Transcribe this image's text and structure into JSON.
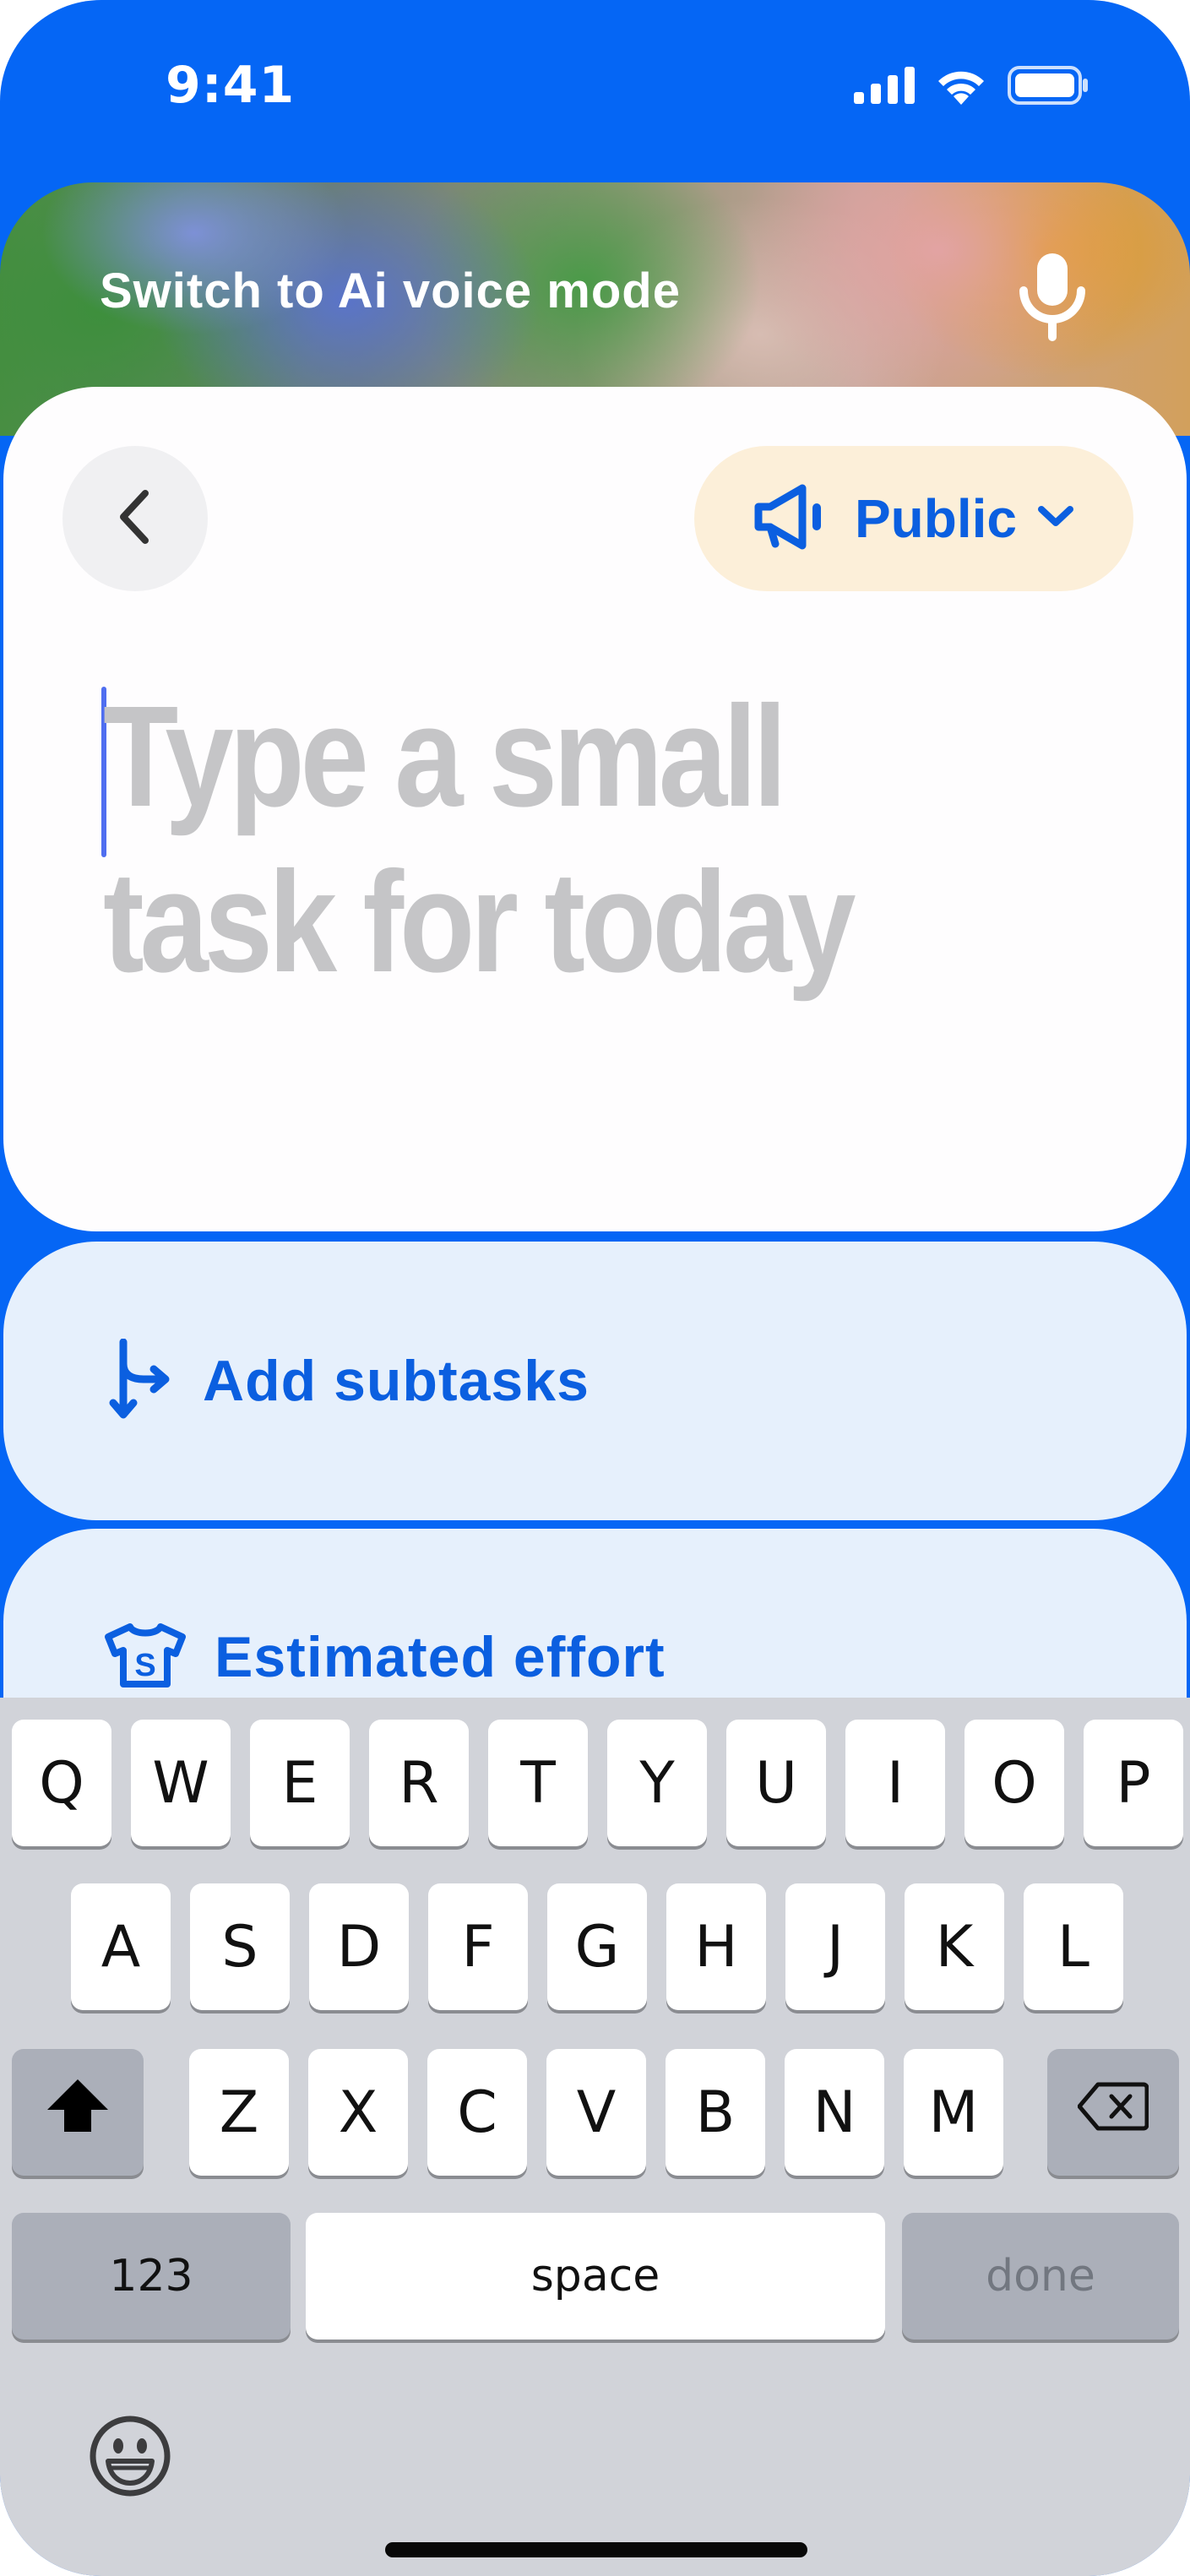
{
  "status_bar": {
    "time": "9:41",
    "signal_icon": "cellular-signal-icon",
    "wifi_icon": "wifi-icon",
    "battery_icon": "battery-icon"
  },
  "voice_banner": {
    "label": "Switch to Ai voice mode",
    "icon": "microphone-icon"
  },
  "task_card": {
    "back_icon": "chevron-left-icon",
    "visibility": {
      "label": "Public",
      "icon": "megaphone-icon",
      "dropdown_icon": "chevron-down-icon"
    },
    "input_placeholder_line1": "Type a small",
    "input_placeholder_line2": "task for today"
  },
  "subtasks": {
    "label": "Add subtasks",
    "icon": "split-arrows-icon"
  },
  "effort": {
    "label": "Estimated effort",
    "icon": "tshirt-size-icon",
    "icon_letter": "S"
  },
  "keyboard": {
    "row1": [
      "Q",
      "W",
      "E",
      "R",
      "T",
      "Y",
      "U",
      "I",
      "O",
      "P"
    ],
    "row2": [
      "A",
      "S",
      "D",
      "F",
      "G",
      "H",
      "J",
      "K",
      "L"
    ],
    "row3": [
      "Z",
      "X",
      "C",
      "V",
      "B",
      "N",
      "M"
    ],
    "shift_icon": "shift-icon",
    "delete_icon": "delete-backspace-icon",
    "numbers_label": "123",
    "space_label": "space",
    "done_label": "done",
    "emoji_icon": "emoji-icon"
  },
  "colors": {
    "accent_blue": "#0566f5",
    "link_blue": "#0b5fe0",
    "public_pill_bg": "#fcefd9",
    "subtask_card_bg": "#e6f0fc",
    "placeholder_gray": "#c5c5c7",
    "keyboard_bg": "#d1d3d9"
  }
}
